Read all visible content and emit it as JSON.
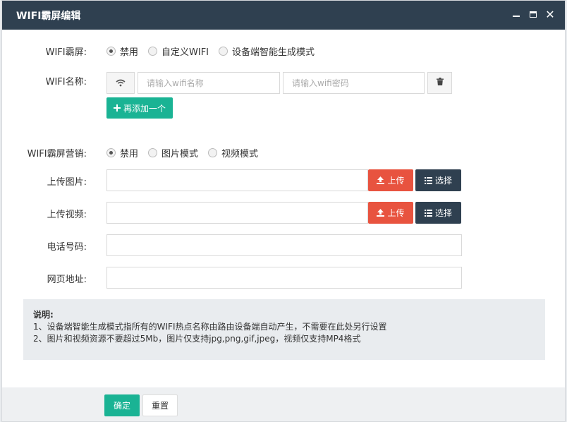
{
  "dialog": {
    "title": "WIFI霸屏编辑"
  },
  "wifi_mode": {
    "label": "WIFI霸屏:",
    "options": [
      "禁用",
      "自定义WIFI",
      "设备端智能生成模式"
    ],
    "selected": "禁用"
  },
  "wifi_name": {
    "label": "WIFI名称:",
    "name_placeholder": "请输入wifi名称",
    "password_placeholder": "请输入wifi密码",
    "add_button": "再添加一个"
  },
  "marketing": {
    "label": "WIFI霸屏营销:",
    "options": [
      "禁用",
      "图片模式",
      "视频模式"
    ],
    "selected": "禁用"
  },
  "upload_image": {
    "label": "上传图片:",
    "value": "",
    "upload_button": "上传",
    "select_button": "选择"
  },
  "upload_video": {
    "label": "上传视频:",
    "value": "",
    "upload_button": "上传",
    "select_button": "选择"
  },
  "phone": {
    "label": "电话号码:",
    "value": ""
  },
  "webpage": {
    "label": "网页地址:",
    "value": ""
  },
  "note": {
    "title": "说明:",
    "lines": [
      "1、设备端智能生成模式指所有的WIFI热点名称由路由设备端自动产生，不需要在此处另行设置",
      "2、图片和视频资源不要超过5Mb，图片仅支持jpg,png,gif,jpeg，视频仅支持MP4格式"
    ]
  },
  "footer": {
    "confirm": "确定",
    "reset": "重置"
  },
  "colors": {
    "titlebar": "#2f4050",
    "primary_green": "#1ab394",
    "upload_red": "#e8533f",
    "select_dark": "#2f4050"
  },
  "icons": [
    "wifi-icon",
    "trash-icon",
    "plus-icon",
    "upload-icon",
    "list-icon",
    "minimize-icon",
    "maximize-icon",
    "close-icon"
  ]
}
